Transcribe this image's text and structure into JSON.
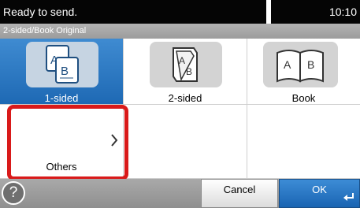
{
  "status": {
    "message": "Ready to send.",
    "time": "10:10"
  },
  "screen": {
    "title": "2-sided/Book Original"
  },
  "options": [
    {
      "label": "1-sided",
      "icon": "one-sided-original-icon",
      "selected": true
    },
    {
      "label": "2-sided",
      "icon": "two-sided-original-icon",
      "selected": false
    },
    {
      "label": "Book",
      "icon": "book-original-icon",
      "selected": false
    }
  ],
  "others": {
    "label": "Others",
    "icon": "chevron-right-icon",
    "highlighted": true
  },
  "footer": {
    "help_label": "?",
    "cancel_label": "Cancel",
    "ok_label": "OK"
  },
  "colors": {
    "selected": "#2a74bf",
    "highlight": "#d91a1a",
    "status_bar": "#050505"
  }
}
